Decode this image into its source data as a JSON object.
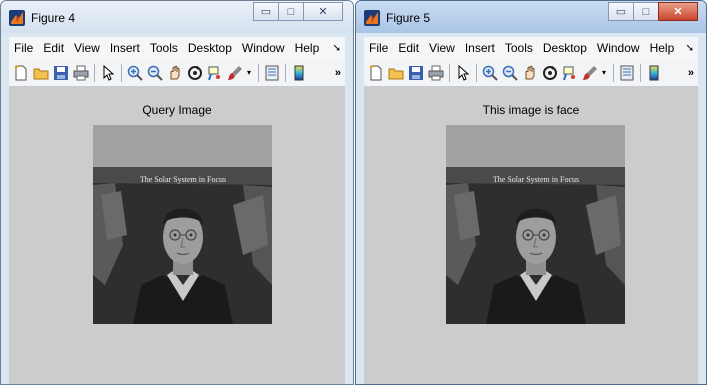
{
  "windows": [
    {
      "title": "Figure 4",
      "menu": [
        "File",
        "Edit",
        "View",
        "Insert",
        "Tools",
        "Desktop",
        "Window",
        "Help"
      ],
      "plot_title": "Query Image"
    },
    {
      "title": "Figure 5",
      "menu": [
        "File",
        "Edit",
        "View",
        "Insert",
        "Tools",
        "Desktop",
        "Window",
        "Help"
      ],
      "plot_title": "This image is face"
    }
  ],
  "photo_caption": "The Solar System in Focus",
  "toolbar_icons": [
    "new-figure-icon",
    "open-file-icon",
    "save-icon",
    "print-icon",
    "pointer-icon",
    "zoom-in-icon",
    "zoom-out-icon",
    "pan-icon",
    "rotate-icon",
    "data-cursor-icon",
    "brush-icon",
    "colorbar-icon",
    "legend-icon"
  ],
  "colors": {
    "canvas": "#cccccc",
    "toolbar": "#f3f4f6",
    "menubar": "#f5f6f7",
    "close_active": "#c9442c"
  }
}
